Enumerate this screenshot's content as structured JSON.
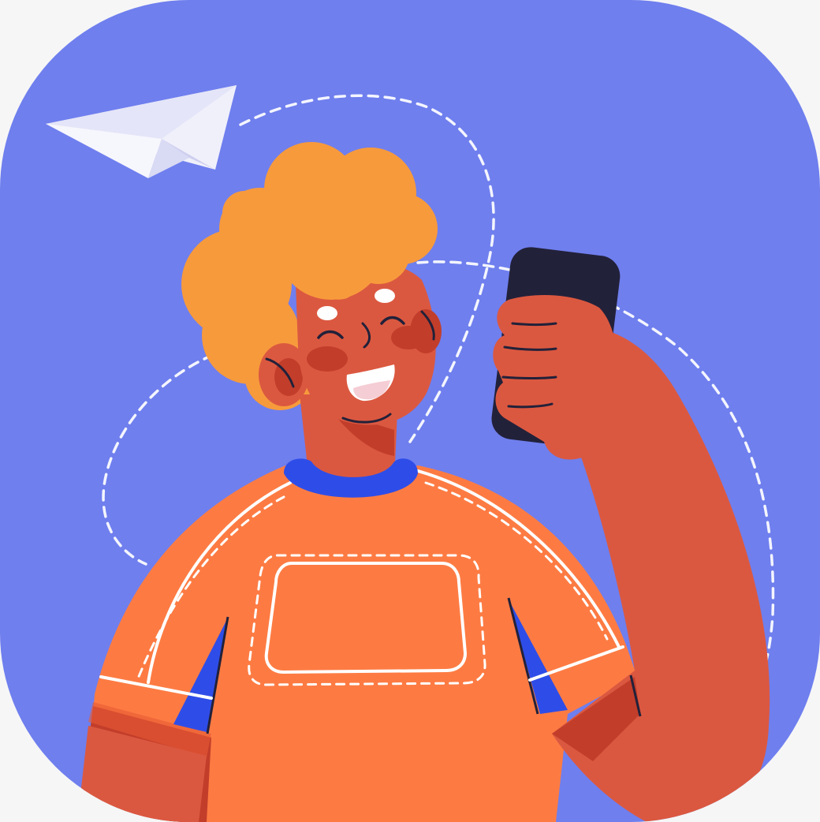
{
  "scene": {
    "subject": "person-with-phone",
    "icons": [
      "paper-plane-icon",
      "smartphone-icon"
    ]
  },
  "colors": {
    "page_background": "#f6f6f6",
    "tile_background": "#6f7fee",
    "hair": "#f79a3c",
    "skin": "#db5840",
    "skin_shadow": "#c23e2a",
    "shirt": "#fd7b43",
    "collar": "#2e4de8",
    "phone": "#22213a",
    "paper_plane": "#f0f0fb",
    "paper_plane_shade": "#d9daf4",
    "dashed_path": "#ffffff"
  }
}
